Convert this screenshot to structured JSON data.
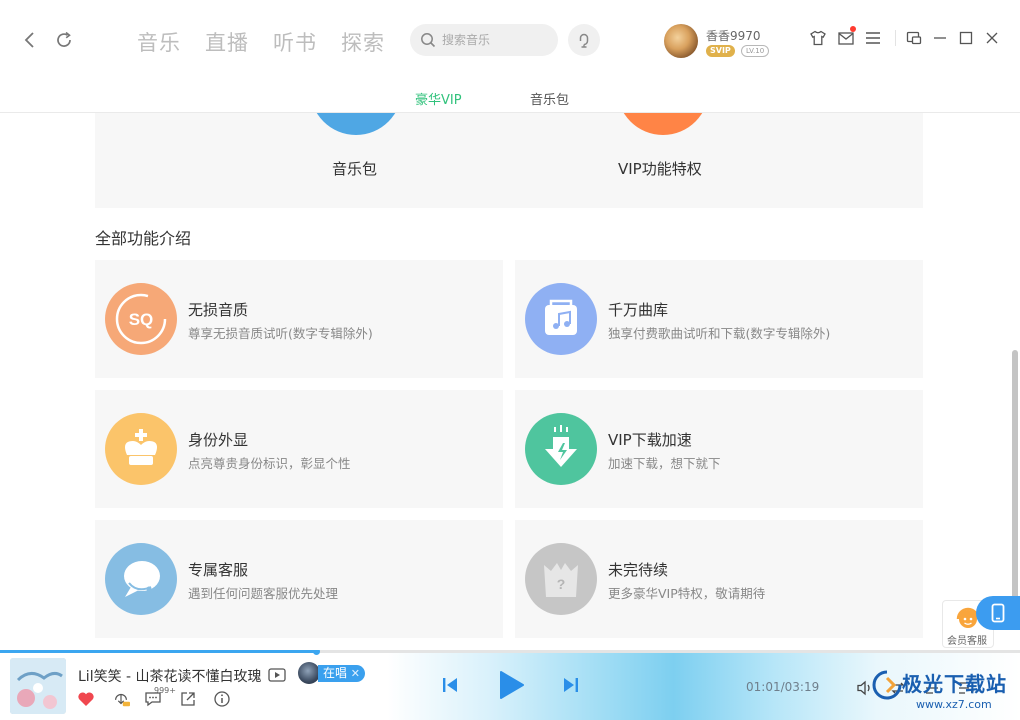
{
  "header": {
    "nav_tabs": [
      "音乐",
      "直播",
      "听书",
      "探索"
    ],
    "search_placeholder": "搜索音乐",
    "user": {
      "name": "香香9970",
      "vip_badge": "SVIP",
      "level": "LV.10"
    }
  },
  "subtabs": [
    {
      "label": "豪华VIP",
      "active": true
    },
    {
      "label": "音乐包",
      "active": false
    }
  ],
  "top_panel": {
    "left_label": "音乐包",
    "right_label": "VIP功能特权"
  },
  "section_title": "全部功能介绍",
  "features": [
    {
      "title": "无损音质",
      "desc": "尊享无损音质试听(数字专辑除外)",
      "icon": "sq-icon",
      "color": "#f6a877",
      "icon_text": "SQ"
    },
    {
      "title": "千万曲库",
      "desc": "独享付费歌曲试听和下载(数字专辑除外)",
      "icon": "music-library-icon",
      "color": "#8fb0f3"
    },
    {
      "title": "身份外显",
      "desc": "点亮尊贵身份标识，彰显个性",
      "icon": "crown-icon",
      "color": "#fbc46a"
    },
    {
      "title": "VIP下载加速",
      "desc": "加速下载，想下就下",
      "icon": "download-speed-icon",
      "color": "#4fc59e"
    },
    {
      "title": "专属客服",
      "desc": "遇到任何问题客服优先处理",
      "icon": "chat-icon",
      "color": "#86bde3"
    },
    {
      "title": "未完待续",
      "desc": "更多豪华VIP特权，敬请期待",
      "icon": "mystery-box-icon",
      "color": "#c6c6c6",
      "icon_text": "?"
    }
  ],
  "service": {
    "label": "会员客服"
  },
  "player": {
    "song": "Lil笑笑 - 山茶花读不懂白玫瑰",
    "singing_label": "在唱",
    "close_mark": "✕",
    "comment_count": "999+",
    "time": "01:01/03:19",
    "progress": 0.31,
    "accent": "#3ba6f0",
    "like_color": "#f0474f"
  },
  "watermark": {
    "title": "极光下载站",
    "url": "www.xz7.com"
  }
}
